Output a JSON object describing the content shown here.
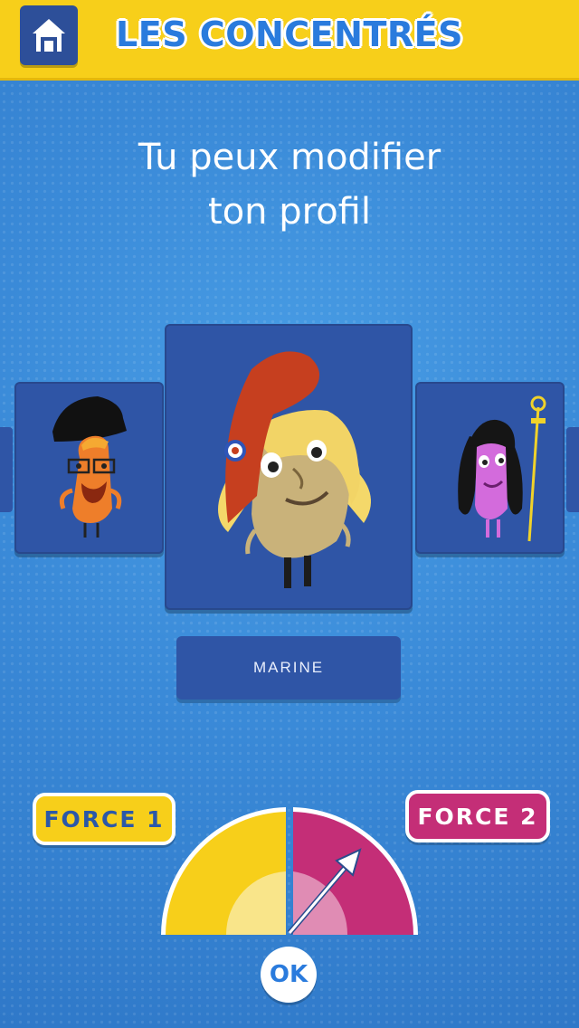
{
  "header": {
    "title": "LES CONCENTRÉS",
    "home_icon": "home-icon"
  },
  "prompt": {
    "line1": "Tu peux modifier",
    "line2": "ton profil"
  },
  "carousel": {
    "selected_name": "MARINE",
    "characters": [
      {
        "position": "left",
        "description_icon": "character-pirate-hat-glasses-icon"
      },
      {
        "position": "center",
        "description_icon": "character-phrygian-cap-blonde-icon"
      },
      {
        "position": "right",
        "description_icon": "character-curly-hair-scepter-icon"
      }
    ]
  },
  "gauge": {
    "left_label": "FORCE 1",
    "right_label": "FORCE 2",
    "ok_label": "OK",
    "colors": {
      "force1": "#f7cf1a",
      "force2": "#c42e77"
    }
  }
}
